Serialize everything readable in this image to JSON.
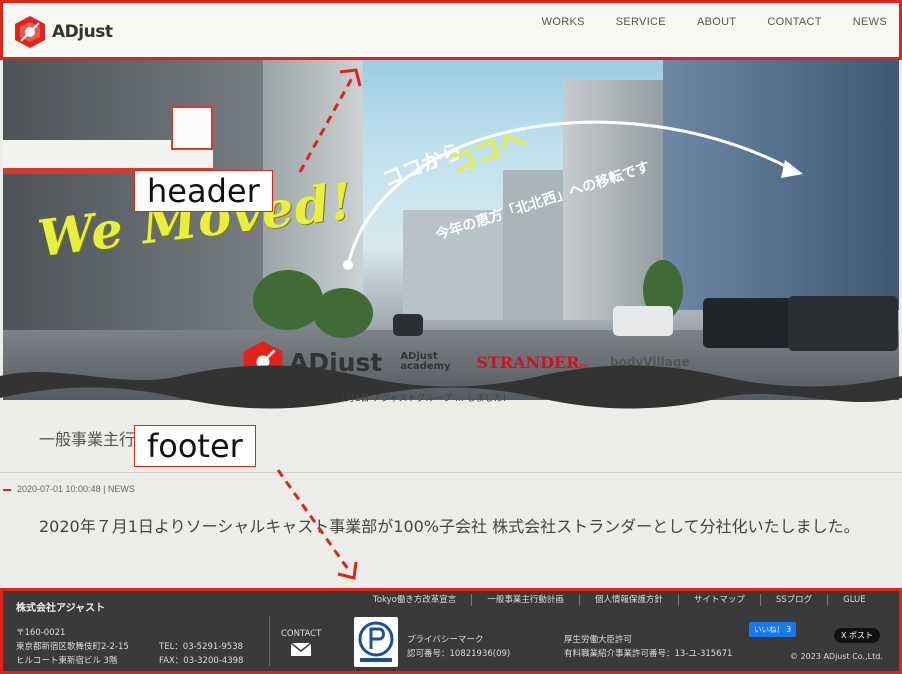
{
  "header": {
    "logo_text": "ADjust",
    "nav": [
      "WORKS",
      "SERVICE",
      "ABOUT",
      "CONTACT",
      "NEWS"
    ]
  },
  "hero": {
    "headline": "We Moved!",
    "catch_a": "ココから",
    "catch_b": "ココへ",
    "catch_c": "今年の恵方「北北西」への移転です",
    "brand_main": "ADjust",
    "brand_academy": "ADjust academy",
    "brand_strander": "STRANDER",
    "brand_strander_suffix": "Inc.",
    "brand_bodyvillage": "bodyVillage",
    "caption": "7月1日 アジャストグループ … しました!"
  },
  "news": {
    "section_title": "一般事業主行",
    "meta": "2020-07-01 10:00:48 | NEWS",
    "article": "2020年７月1日よりソーシャルキャスト事業部が100%子会社 株式会社ストランダーとして分社化いたしました。"
  },
  "annotations": {
    "header_label": "header",
    "footer_label": "footer",
    "color": "#e2231a"
  },
  "footer": {
    "company": "株式会社アジャスト",
    "links": [
      "Tokyo働き方改革宣言",
      "一般事業主行動計画",
      "個人情報保護方針",
      "サイトマップ",
      "SSブログ",
      "GLUE"
    ],
    "postal": "〒160-0021",
    "address1": "東京都新宿区歌舞伎町2-2-15",
    "address2": "ヒルコート東新宿ビル 3階",
    "tel": "TEL：03-5291-9538",
    "fax": "FAX：03-3200-4398",
    "contact_label": "CONTACT",
    "pmark_title": "プライバシーマーク",
    "pmark_number": "認可番号：10821936(09)",
    "license_title": "厚生労働大臣許可",
    "license_number": "有料職業紹介事業許可番号：13-ユ-315671",
    "like_button": "いいね！ 3",
    "post_button": "X ポスト",
    "copyright": "© 2023 ADjust Co.,Ltd."
  },
  "colors": {
    "accent": "#e2231a",
    "hero_headline": "#e9ef3a",
    "footer_bg": "#3a3a3a"
  }
}
